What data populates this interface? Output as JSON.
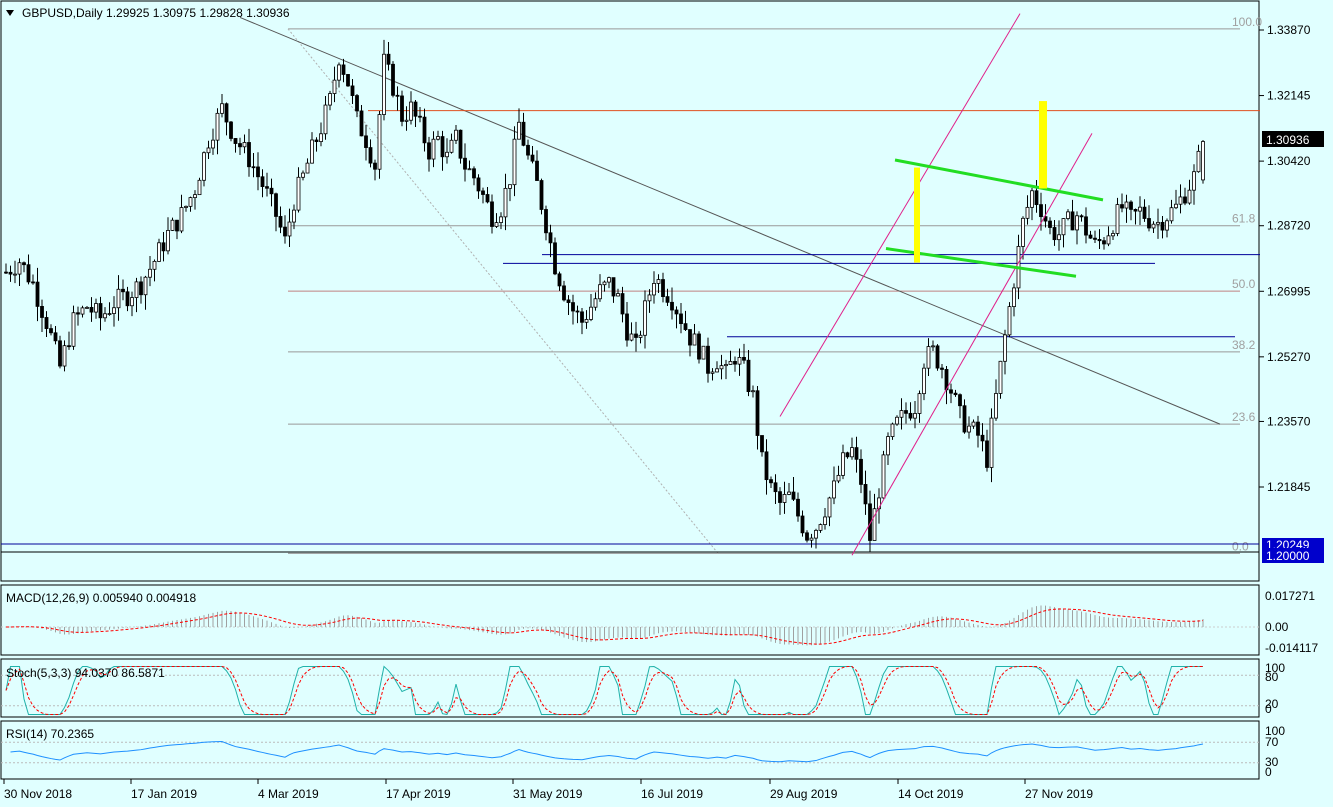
{
  "colors": {
    "background": "#e0ffff",
    "panel_bg": "#e0ffff",
    "candle": "#000000",
    "fib_line": "#999999",
    "resistance": "#e05020",
    "channel": "#e0208a",
    "flag": "#22dd22",
    "highlight": "#ffff00",
    "blue_line": "#000099",
    "macd_hist": "#a0a0a0",
    "macd_signal": "#ff0000",
    "stoch_main": "#20b2aa",
    "stoch_signal": "#ff0000",
    "rsi": "#1e90ff",
    "price_tag_bg": "#000000",
    "blue_tag_bg": "#0000cc"
  },
  "main": {
    "title": "GBPUSD,Daily  1.29925 1.30975 1.29828 1.30936",
    "current_price": "1.30936",
    "tag_1": "1.20249",
    "tag_2": "1.20000"
  },
  "chart_data": {
    "type": "candlestick",
    "symbol": "GBPUSD",
    "timeframe": "Daily",
    "ohlc_last": {
      "open": 1.29925,
      "high": 1.30975,
      "low": 1.29828,
      "close": 1.30936
    },
    "y_ticks": [
      "1.33870",
      "1.32145",
      "1.30420",
      "1.28720",
      "1.26995",
      "1.25270",
      "1.23570",
      "1.21845"
    ],
    "x_ticks": [
      "30 Nov 2018",
      "17 Jan 2019",
      "4 Mar 2019",
      "17 Apr 2019",
      "31 May 2019",
      "16 Jul 2019",
      "29 Aug 2019",
      "14 Oct 2019",
      "27 Nov 2019"
    ],
    "fib_levels": [
      {
        "label": "100.0",
        "price": 1.339
      },
      {
        "label": "61.8",
        "price": 1.2872
      },
      {
        "label": "50.0",
        "price": 1.27
      },
      {
        "label": "38.2",
        "price": 1.254
      },
      {
        "label": "23.6",
        "price": 1.235
      },
      {
        "label": "0.0",
        "price": 1.201
      }
    ],
    "price_path": [
      [
        0,
        1.275
      ],
      [
        3,
        1.278
      ],
      [
        6,
        1.272
      ],
      [
        9,
        1.262
      ],
      [
        12,
        1.25
      ],
      [
        15,
        1.262
      ],
      [
        18,
        1.266
      ],
      [
        21,
        1.263
      ],
      [
        24,
        1.267
      ],
      [
        27,
        1.269
      ],
      [
        30,
        1.272
      ],
      [
        33,
        1.278
      ],
      [
        36,
        1.285
      ],
      [
        39,
        1.29
      ],
      [
        42,
        1.297
      ],
      [
        45,
        1.31
      ],
      [
        48,
        1.318
      ],
      [
        51,
        1.31
      ],
      [
        54,
        1.305
      ],
      [
        57,
        1.298
      ],
      [
        60,
        1.29
      ],
      [
        62,
        1.283
      ],
      [
        64,
        1.294
      ],
      [
        66,
        1.3
      ],
      [
        68,
        1.307
      ],
      [
        70,
        1.313
      ],
      [
        72,
        1.32
      ],
      [
        74,
        1.332
      ],
      [
        76,
        1.325
      ],
      [
        78,
        1.315
      ],
      [
        80,
        1.31
      ],
      [
        82,
        1.303
      ],
      [
        84,
        1.33
      ],
      [
        86,
        1.324
      ],
      [
        88,
        1.316
      ],
      [
        90,
        1.318
      ],
      [
        92,
        1.313
      ],
      [
        94,
        1.307
      ],
      [
        96,
        1.31
      ],
      [
        98,
        1.305
      ],
      [
        100,
        1.31
      ],
      [
        102,
        1.303
      ],
      [
        104,
        1.3
      ],
      [
        106,
        1.295
      ],
      [
        108,
        1.29
      ],
      [
        110,
        1.292
      ],
      [
        112,
        1.3
      ],
      [
        114,
        1.314
      ],
      [
        116,
        1.305
      ],
      [
        118,
        1.298
      ],
      [
        120,
        1.288
      ],
      [
        122,
        1.277
      ],
      [
        124,
        1.27
      ],
      [
        126,
        1.265
      ],
      [
        128,
        1.262
      ],
      [
        130,
        1.266
      ],
      [
        132,
        1.27
      ],
      [
        134,
        1.272
      ],
      [
        136,
        1.268
      ],
      [
        138,
        1.26
      ],
      [
        140,
        1.255
      ],
      [
        142,
        1.265
      ],
      [
        144,
        1.274
      ],
      [
        146,
        1.271
      ],
      [
        148,
        1.268
      ],
      [
        150,
        1.263
      ],
      [
        152,
        1.258
      ],
      [
        154,
        1.255
      ],
      [
        156,
        1.25
      ],
      [
        158,
        1.252
      ],
      [
        160,
        1.248
      ],
      [
        162,
        1.253
      ],
      [
        164,
        1.249
      ],
      [
        166,
        1.242
      ],
      [
        168,
        1.225
      ],
      [
        170,
        1.218
      ],
      [
        172,
        1.214
      ],
      [
        174,
        1.216
      ],
      [
        176,
        1.211
      ],
      [
        178,
        1.206
      ],
      [
        180,
        1.208
      ],
      [
        182,
        1.213
      ],
      [
        184,
        1.218
      ],
      [
        186,
        1.225
      ],
      [
        188,
        1.228
      ],
      [
        190,
        1.22
      ],
      [
        192,
        1.205
      ],
      [
        194,
        1.218
      ],
      [
        196,
        1.23
      ],
      [
        198,
        1.235
      ],
      [
        200,
        1.238
      ],
      [
        202,
        1.24
      ],
      [
        204,
        1.252
      ],
      [
        206,
        1.254
      ],
      [
        208,
        1.25
      ],
      [
        210,
        1.244
      ],
      [
        212,
        1.237
      ],
      [
        214,
        1.234
      ],
      [
        216,
        1.232
      ],
      [
        218,
        1.226
      ],
      [
        220,
        1.242
      ],
      [
        222,
        1.258
      ],
      [
        224,
        1.273
      ],
      [
        226,
        1.288
      ],
      [
        228,
        1.296
      ],
      [
        230,
        1.292
      ],
      [
        232,
        1.286
      ],
      [
        234,
        1.285
      ],
      [
        236,
        1.288
      ],
      [
        238,
        1.29
      ],
      [
        240,
        1.286
      ],
      [
        242,
        1.282
      ],
      [
        244,
        1.284
      ],
      [
        246,
        1.288
      ],
      [
        248,
        1.292
      ],
      [
        250,
        1.289
      ],
      [
        252,
        1.291
      ],
      [
        254,
        1.289
      ],
      [
        256,
        1.288
      ],
      [
        258,
        1.29
      ],
      [
        260,
        1.292
      ],
      [
        262,
        1.296
      ],
      [
        264,
        1.3
      ],
      [
        266,
        1.309
      ]
    ],
    "macd": {
      "label": "MACD(12,26,9) 0.005940 0.004918",
      "ticks": [
        "0.017271",
        "0.00",
        "-0.014117"
      ]
    },
    "stochastic": {
      "label": "Stoch(5,3,3) 94.0370 86.5871",
      "ticks": [
        "100",
        "80",
        "20",
        "0"
      ]
    },
    "rsi": {
      "label": "RSI(14) 70.2365",
      "ticks": [
        "100",
        "70",
        "30",
        "0"
      ]
    }
  }
}
